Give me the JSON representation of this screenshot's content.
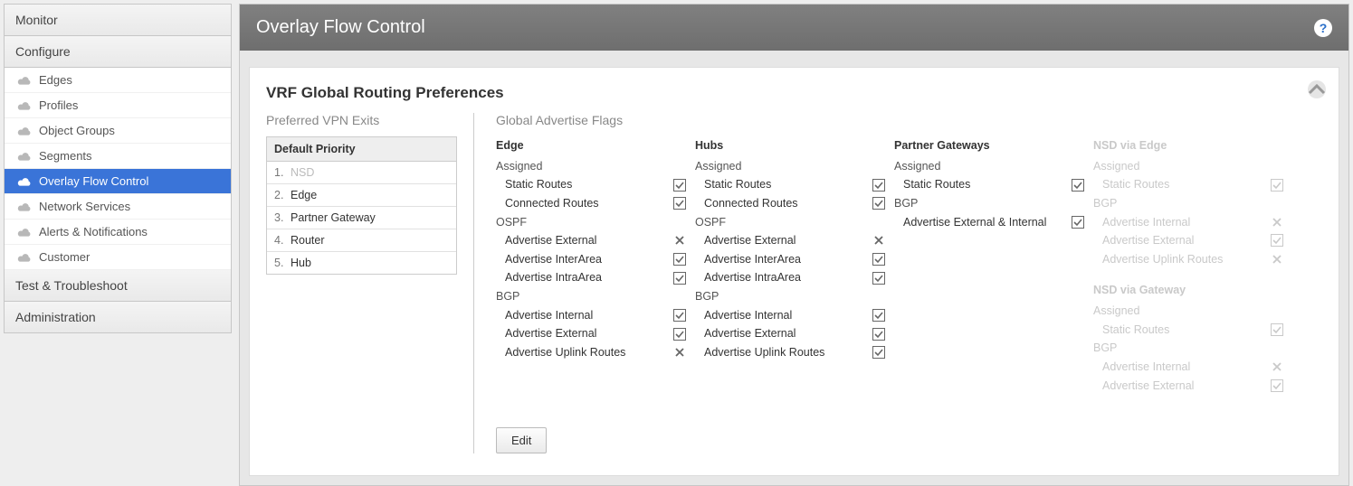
{
  "sidebar": {
    "sections": [
      {
        "label": "Monitor",
        "items": []
      },
      {
        "label": "Configure",
        "items": [
          {
            "label": "Edges"
          },
          {
            "label": "Profiles"
          },
          {
            "label": "Object Groups"
          },
          {
            "label": "Segments"
          },
          {
            "label": "Overlay Flow Control",
            "active": true
          },
          {
            "label": "Network Services"
          },
          {
            "label": "Alerts & Notifications"
          },
          {
            "label": "Customer"
          }
        ]
      },
      {
        "label": "Test & Troubleshoot",
        "items": []
      },
      {
        "label": "Administration",
        "items": []
      }
    ]
  },
  "page": {
    "title": "Overlay Flow Control",
    "help": "?"
  },
  "card": {
    "title": "VRF Global Routing Preferences",
    "collapse_glyph": "⌃",
    "vpn_exits": {
      "title": "Preferred VPN Exits",
      "header": "Default Priority",
      "rows": [
        {
          "n": "1.",
          "label": "NSD",
          "disabled": true
        },
        {
          "n": "2.",
          "label": "Edge"
        },
        {
          "n": "3.",
          "label": "Partner Gateway"
        },
        {
          "n": "4.",
          "label": "Router"
        },
        {
          "n": "5.",
          "label": "Hub"
        }
      ]
    },
    "flags": {
      "title": "Global Advertise Flags",
      "columns": [
        {
          "title": "Edge",
          "groups": [
            {
              "label": "Assigned",
              "items": [
                {
                  "label": "Static Routes",
                  "state": "checked"
                },
                {
                  "label": "Connected Routes",
                  "state": "checked"
                }
              ]
            },
            {
              "label": "OSPF",
              "items": [
                {
                  "label": "Advertise External",
                  "state": "unchecked"
                },
                {
                  "label": "Advertise InterArea",
                  "state": "checked"
                },
                {
                  "label": "Advertise IntraArea",
                  "state": "checked"
                }
              ]
            },
            {
              "label": "BGP",
              "items": [
                {
                  "label": "Advertise Internal",
                  "state": "checked"
                },
                {
                  "label": "Advertise External",
                  "state": "checked"
                },
                {
                  "label": "Advertise Uplink Routes",
                  "state": "unchecked"
                }
              ]
            }
          ]
        },
        {
          "title": "Hubs",
          "groups": [
            {
              "label": "Assigned",
              "items": [
                {
                  "label": "Static Routes",
                  "state": "checked"
                },
                {
                  "label": "Connected Routes",
                  "state": "checked"
                }
              ]
            },
            {
              "label": "OSPF",
              "items": [
                {
                  "label": "Advertise External",
                  "state": "unchecked"
                },
                {
                  "label": "Advertise InterArea",
                  "state": "checked"
                },
                {
                  "label": "Advertise IntraArea",
                  "state": "checked"
                }
              ]
            },
            {
              "label": "BGP",
              "items": [
                {
                  "label": "Advertise Internal",
                  "state": "checked"
                },
                {
                  "label": "Advertise External",
                  "state": "checked"
                },
                {
                  "label": "Advertise Uplink Routes",
                  "state": "checked"
                }
              ]
            }
          ]
        },
        {
          "title": "Partner Gateways",
          "groups": [
            {
              "label": "Assigned",
              "items": [
                {
                  "label": "Static Routes",
                  "state": "checked"
                }
              ]
            },
            {
              "label": "BGP",
              "items": [
                {
                  "label": "Advertise External & Internal",
                  "state": "checked"
                }
              ]
            }
          ]
        },
        {
          "title": "NSD via Edge",
          "ghost": true,
          "groups": [
            {
              "label": "Assigned",
              "items": [
                {
                  "label": "Static Routes",
                  "state": "checked"
                }
              ]
            },
            {
              "label": "BGP",
              "items": [
                {
                  "label": "Advertise Internal",
                  "state": "unchecked"
                },
                {
                  "label": "Advertise External",
                  "state": "checked"
                },
                {
                  "label": "Advertise Uplink Routes",
                  "state": "unchecked"
                }
              ]
            }
          ],
          "second": {
            "title": "NSD via Gateway",
            "groups": [
              {
                "label": "Assigned",
                "items": [
                  {
                    "label": "Static Routes",
                    "state": "checked"
                  }
                ]
              },
              {
                "label": "BGP",
                "items": [
                  {
                    "label": "Advertise Internal",
                    "state": "unchecked"
                  },
                  {
                    "label": "Advertise External",
                    "state": "checked"
                  }
                ]
              }
            ]
          }
        }
      ]
    },
    "edit_label": "Edit"
  }
}
